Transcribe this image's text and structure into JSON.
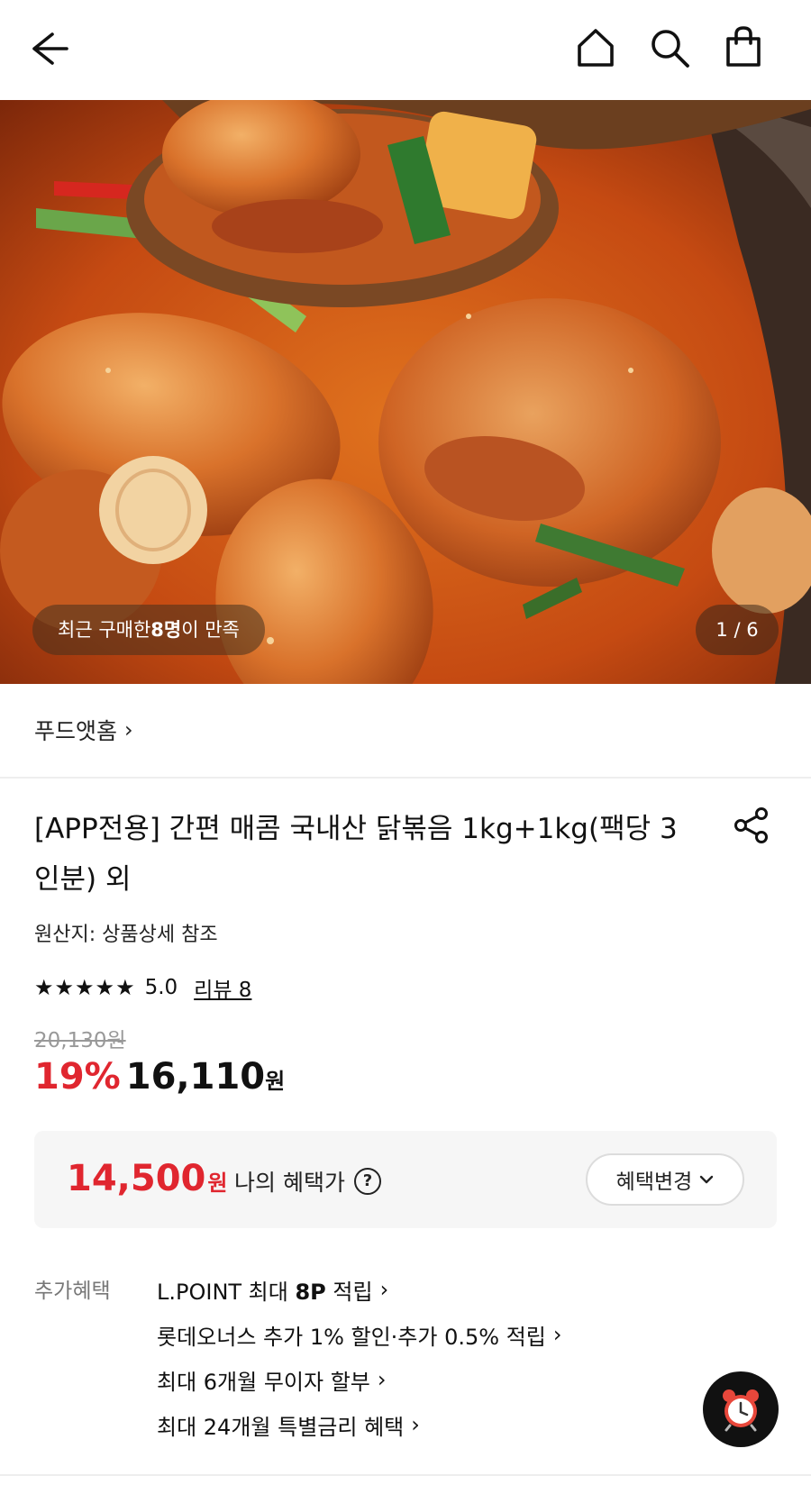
{
  "header": {
    "back_icon": "back-arrow-icon",
    "home_icon": "home-icon",
    "search_icon": "search-icon",
    "bag_icon": "shopping-bag-icon"
  },
  "hero": {
    "satisfaction_prefix": "최근 구매한 ",
    "satisfaction_count": "8명",
    "satisfaction_suffix": "이 만족",
    "image_counter": "1 / 6"
  },
  "seller": {
    "name": "푸드앳홈",
    "chevron": "›"
  },
  "product": {
    "title": "[APP전용] 간편 매콤 국내산 닭볶음 1kg+1kg(팩당 3인분) 외",
    "share_icon": "share-icon",
    "origin": "원산지: 상품상세 참조",
    "stars": "★★★★★",
    "rating": "5.0",
    "review_link": "리뷰 8",
    "original_price": "20,130원",
    "discount_rate": "19%",
    "sale_price": "16,110",
    "currency": "원"
  },
  "benefit": {
    "price": "14,500",
    "currency": "원",
    "label": "나의 혜택가",
    "help_icon": "?",
    "change_button": "혜택변경",
    "change_chevron": "⌄"
  },
  "extra_benefits": {
    "label": "추가혜택",
    "items": [
      {
        "prefix": "L.POINT 최대 ",
        "bold": "8P",
        "suffix": " 적립",
        "chevron": "›"
      },
      {
        "prefix": "롯데오너스 추가 1% 할인·추가 0.5% 적립",
        "bold": "",
        "suffix": "",
        "chevron": "›"
      },
      {
        "prefix": "최대 6개월 무이자 할부",
        "bold": "",
        "suffix": "",
        "chevron": "›"
      },
      {
        "prefix": "최대 24개월 특별금리 혜택",
        "bold": "",
        "suffix": "",
        "chevron": "›"
      }
    ]
  },
  "floating": {
    "alarm_icon": "alarm-clock-icon"
  },
  "colors": {
    "accent_red": "#e0262f",
    "text": "#111111",
    "muted": "#777777",
    "box_bg": "#f6f6f6"
  }
}
